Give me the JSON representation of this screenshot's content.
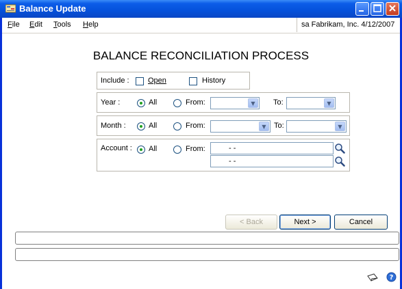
{
  "window": {
    "title": "Balance Update",
    "colors": {
      "titlebar": "#0551db",
      "frame": "#0831d9",
      "accent": "#21a121"
    }
  },
  "menubar": {
    "items": [
      {
        "label": "File",
        "mnemonic": "F",
        "rest": "ile"
      },
      {
        "label": "Edit",
        "mnemonic": "E",
        "rest": "dit"
      },
      {
        "label": "Tools",
        "mnemonic": "T",
        "rest": "ools"
      },
      {
        "label": "Help",
        "mnemonic": "H",
        "rest": "elp"
      }
    ],
    "status": "sa  Fabrikam, Inc.  4/12/2007"
  },
  "page": {
    "title": "BALANCE RECONCILIATION PROCESS"
  },
  "include": {
    "label": "Include :",
    "open_label": "Open",
    "history_label": "History",
    "open_checked": false,
    "history_checked": false
  },
  "year": {
    "label": "Year :",
    "all_label": "All",
    "from_label": "From:",
    "to_label": "To:",
    "selected": "All",
    "from_value": "",
    "to_value": ""
  },
  "month": {
    "label": "Month :",
    "all_label": "All",
    "from_label": "From:",
    "to_label": "To:",
    "selected": "All",
    "from_value": "",
    "to_value": ""
  },
  "account": {
    "label": "Account :",
    "all_label": "All",
    "from_label": "From:",
    "selected": "All",
    "from_mask": "-          -",
    "to_mask": "-          -"
  },
  "buttons": {
    "back": "< Back",
    "next": "Next >",
    "cancel": "Cancel"
  },
  "icons": {
    "title_icon": "balance-update-icon",
    "lookup": "magnifier-lookup-icon",
    "notes": "note-icon",
    "help": "help-icon"
  }
}
